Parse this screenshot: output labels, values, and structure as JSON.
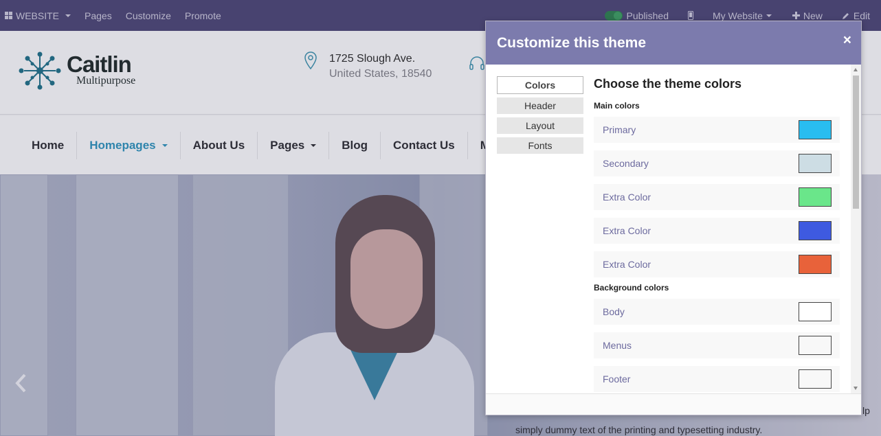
{
  "topbar": {
    "website_label": "WEBSITE",
    "pages": "Pages",
    "customize": "Customize",
    "promote": "Promote",
    "published": "Published",
    "my_website": "My Website",
    "new": "New",
    "edit": "Edit"
  },
  "site": {
    "logo_title": "Caitlin",
    "logo_sub": "Multipurpose",
    "address_line1": "1725 Slough Ave.",
    "address_line2": "United States, 18540",
    "nav": [
      "Home",
      "Homepages",
      "About Us",
      "Pages",
      "Blog",
      "Contact Us",
      "M"
    ],
    "hero_text": "simply dummy text of the printing and typesetting industry.",
    "hero_text_right": "lp"
  },
  "modal": {
    "title": "Customize this theme",
    "close": "×",
    "tabs": [
      "Colors",
      "Header",
      "Layout",
      "Fonts"
    ],
    "heading": "Choose the theme colors",
    "main_label": "Main colors",
    "main_colors": [
      {
        "name": "Primary",
        "color": "#29bdf0"
      },
      {
        "name": "Secondary",
        "color": "#cddde4"
      },
      {
        "name": "Extra Color",
        "color": "#6ae68a"
      },
      {
        "name": "Extra Color",
        "color": "#3e5ae0"
      },
      {
        "name": "Extra Color",
        "color": "#e8623a"
      }
    ],
    "bg_label": "Background colors",
    "bg_colors": [
      {
        "name": "Body",
        "color": "#ffffff"
      },
      {
        "name": "Menus",
        "color": "#f8f8f8"
      },
      {
        "name": "Footer",
        "color": "#f8f8f8"
      }
    ]
  },
  "colors": {
    "topbar": "#4b4574",
    "modal_header": "#7c7bad",
    "nav_active": "#2d8fb8"
  }
}
